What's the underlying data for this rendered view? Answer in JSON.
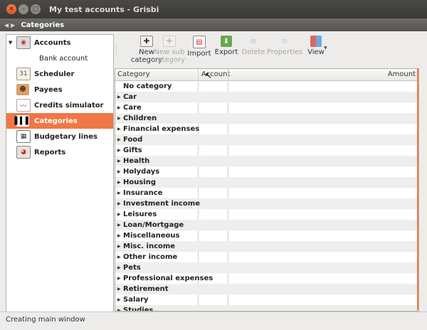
{
  "window": {
    "title": "My test accounts - Grisbi",
    "nav_title": "Categories"
  },
  "sidebar": {
    "items": [
      {
        "label": "Accounts",
        "icon": "accounts-icon",
        "expanded": true
      },
      {
        "label": "Bank account",
        "icon": "bank-icon",
        "child": true
      },
      {
        "label": "Scheduler",
        "icon": "calendar-icon"
      },
      {
        "label": "Payees",
        "icon": "payees-icon"
      },
      {
        "label": "Credits simulator",
        "icon": "chart-icon"
      },
      {
        "label": "Categories",
        "icon": "barcode-icon",
        "selected": true
      },
      {
        "label": "Budgetary lines",
        "icon": "budget-icon"
      },
      {
        "label": "Reports",
        "icon": "reports-icon"
      }
    ]
  },
  "toolbar": {
    "new_category": "New category",
    "new_sub_category": "New sub category",
    "import": "Import",
    "export": "Export",
    "delete": "Delete",
    "properties": "Properties",
    "view": "View"
  },
  "tree": {
    "columns": [
      "Category",
      "Account",
      "Amount"
    ],
    "rows": [
      {
        "name": "No category",
        "expander": false
      },
      {
        "name": "Car",
        "expander": true
      },
      {
        "name": "Care",
        "expander": true
      },
      {
        "name": "Children",
        "expander": true
      },
      {
        "name": "Financial expenses",
        "expander": true
      },
      {
        "name": "Food",
        "expander": true
      },
      {
        "name": "Gifts",
        "expander": true
      },
      {
        "name": "Health",
        "expander": true
      },
      {
        "name": "Holydays",
        "expander": true
      },
      {
        "name": "Housing",
        "expander": true
      },
      {
        "name": "Insurance",
        "expander": true
      },
      {
        "name": "Investment income",
        "expander": true
      },
      {
        "name": "Leisures",
        "expander": true
      },
      {
        "name": "Loan/Mortgage",
        "expander": true
      },
      {
        "name": "Miscellaneous",
        "expander": true
      },
      {
        "name": "Misc. income",
        "expander": true
      },
      {
        "name": "Other income",
        "expander": true
      },
      {
        "name": "Pets",
        "expander": true
      },
      {
        "name": "Professional expenses",
        "expander": true
      },
      {
        "name": "Retirement",
        "expander": true
      },
      {
        "name": "Salary",
        "expander": true
      },
      {
        "name": "Studies",
        "expander": true
      }
    ]
  },
  "status": {
    "text": "Creating main window"
  },
  "colors": {
    "accent": "#f07746",
    "titlebar": "#3c3b37"
  }
}
